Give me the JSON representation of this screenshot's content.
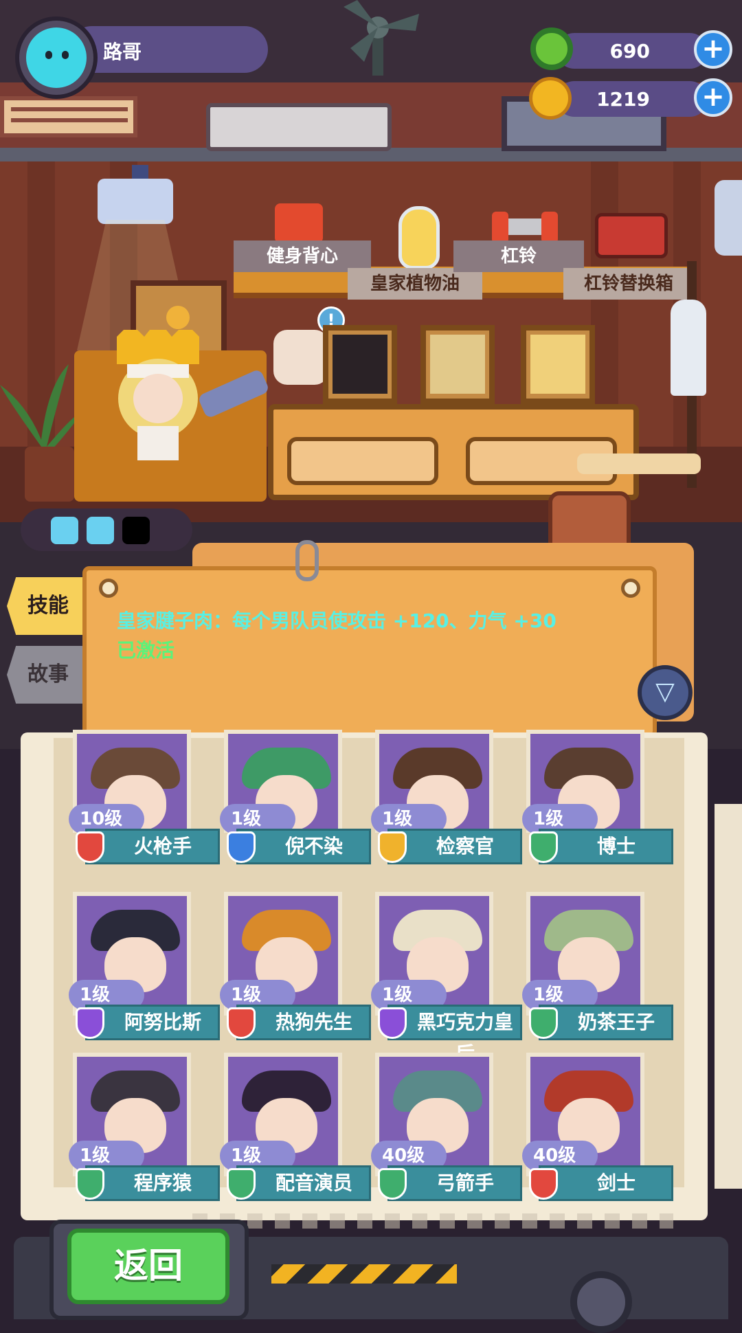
{
  "player": {
    "name": "路哥"
  },
  "currencies": [
    {
      "icon": "donut-coin-icon",
      "value": "690"
    },
    {
      "icon": "planet-coin-icon",
      "value": "1219"
    }
  ],
  "room_items": [
    {
      "name": "健身背心",
      "icon": "vest-icon"
    },
    {
      "name": "皇家植物油",
      "icon": "oil-bottle-icon"
    },
    {
      "name": "杠铃",
      "icon": "barbell-icon"
    },
    {
      "name": "杠铃替换箱",
      "icon": "toolbox-icon"
    }
  ],
  "info_badge": "!",
  "side_tabs": {
    "skill": "技能",
    "story": "故事"
  },
  "skill": {
    "description": "皇家腱子肉：每个男队员使攻击 +120、力气 +30",
    "status": "已激活"
  },
  "filter_icon": "filter-icon",
  "characters": [
    {
      "name": "火枪手",
      "level": "10级",
      "shield_color": "#e2483e",
      "bg": "#7e5fb3",
      "hair": "#6a4a38"
    },
    {
      "name": "倪不染",
      "level": "1级",
      "shield_color": "#3b7fe0",
      "bg": "#7e5fb3",
      "hair": "#3e9a66"
    },
    {
      "name": "检察官",
      "level": "1级",
      "shield_color": "#f0b22c",
      "bg": "#7e5fb3",
      "hair": "#5a3a2a"
    },
    {
      "name": "博士",
      "level": "1级",
      "shield_color": "#3fae6d",
      "bg": "#7e5fb3",
      "hair": "#5a3e30"
    },
    {
      "name": "阿努比斯",
      "level": "1级",
      "shield_color": "#8a4fd8",
      "bg": "#7e5fb3",
      "hair": "#2a2a3a"
    },
    {
      "name": "热狗先生",
      "level": "1级",
      "shield_color": "#e2483e",
      "bg": "#7e5fb3",
      "hair": "#d98a2a"
    },
    {
      "name": "黑巧克力皇后",
      "level": "1级",
      "shield_color": "#8a4fd8",
      "bg": "#7e5fb3",
      "hair": "#e9e0c8"
    },
    {
      "name": "奶茶王子",
      "level": "1级",
      "shield_color": "#3fae6d",
      "bg": "#7e5fb3",
      "hair": "#9fb98a"
    },
    {
      "name": "程序猿",
      "level": "1级",
      "shield_color": "#3fae6d",
      "bg": "#7e5fb3",
      "hair": "#3a3440"
    },
    {
      "name": "配音演员",
      "level": "1级",
      "shield_color": "#3fae6d",
      "bg": "#7e5fb3",
      "hair": "#2e2238"
    },
    {
      "name": "弓箭手",
      "level": "40级",
      "shield_color": "#3fae6d",
      "bg": "#7e5fb3",
      "hair": "#5a8a8a"
    },
    {
      "name": "剑士",
      "level": "40级",
      "shield_color": "#e2483e",
      "bg": "#7e5fb3",
      "hair": "#b23a2a"
    }
  ],
  "back_button": "返回",
  "colors": {
    "accent_green": "#5ad15b",
    "skill_text": "#58f0e4",
    "active_text": "#5bf37a",
    "card_bar": "#3a8e9c"
  }
}
